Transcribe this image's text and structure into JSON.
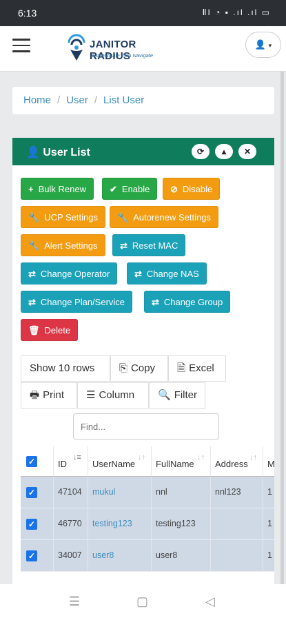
{
  "status": {
    "time": "6:13",
    "icons": "ⅡI ◔ ▪ .ıl .ıl ▭",
    "battery": "46"
  },
  "app": {
    "logo_title": "JANITOR RADIUS",
    "logo_sub": "Authenticate then Navigate",
    "colors": {
      "brand": "#1f3a5f",
      "accent": "#2e6fa7",
      "header": "#0f7d5c"
    }
  },
  "breadcrumb": {
    "items": [
      "Home",
      "User",
      "List User"
    ]
  },
  "panel": {
    "title": "User List"
  },
  "buttons": {
    "bulk_renew": "Bulk Renew",
    "enable": "Enable",
    "disable": "Disable",
    "ucp_settings": "UCP Settings",
    "autorenew_settings": "Autorenew Settings",
    "alert_settings": "Alert Settings",
    "reset_mac": "Reset MAC",
    "change_operator": "Change Operator",
    "change_nas": "Change NAS",
    "change_plan": "Change Plan/Service",
    "change_group": "Change Group",
    "delete": "Delete"
  },
  "datatable": {
    "show_rows": "Show 10 rows",
    "copy": "Copy",
    "excel": "Excel",
    "print": "Print",
    "column": "Column",
    "filter": "Filter",
    "search_placeholder": "Find...",
    "headers": [
      "ID",
      "UserName",
      "FullName",
      "Address",
      "M"
    ],
    "rows": [
      {
        "id": "47104",
        "username": "mukul",
        "fullname": "nnl",
        "address": "nnl123",
        "extra": "1"
      },
      {
        "id": "46770",
        "username": "testing123",
        "fullname": "testing123",
        "address": "",
        "extra": "1"
      },
      {
        "id": "34007",
        "username": "user8",
        "fullname": "user8",
        "address": "",
        "extra": "1"
      }
    ]
  }
}
